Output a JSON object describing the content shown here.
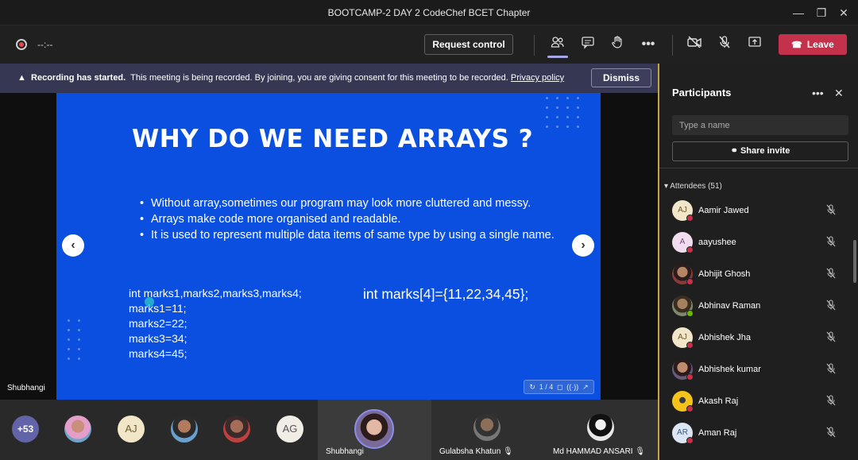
{
  "window": {
    "title": "BOOTCAMP-2 DAY 2 CodeChef BCET Chapter"
  },
  "toolbar": {
    "timer": "--:--",
    "request_control_label": "Request control",
    "leave_label": "Leave"
  },
  "banner": {
    "bold_text": "Recording has started.",
    "message": "This meeting is being recorded. By joining, you are giving consent for this meeting to be recorded.",
    "link_text": "Privacy policy",
    "dismiss_label": "Dismiss"
  },
  "slide": {
    "title": "WHY DO WE NEED ARRAYS ?",
    "bullets": [
      "Without array,sometimes our program may look more cluttered and messy.",
      "Arrays make code more organised and readable.",
      "It is used to represent multiple data items of same type by using a single name."
    ],
    "code_left": [
      "int marks1,marks2,marks3,marks4;",
      "marks1=11;",
      "marks2=22;",
      "marks3=34;",
      "marks4=45;"
    ],
    "code_right": "int marks[4]={11,22,34,45};",
    "page_indicator": "1 / 4",
    "presenter": "Shubhangi"
  },
  "gallery": {
    "overflow_count": "+53",
    "initials_1": "AJ",
    "initials_2": "AG",
    "tiles": [
      {
        "name": "Shubhangi"
      },
      {
        "name": "Gulabsha Khatun"
      },
      {
        "name": "Md HAMMAD ANSARI"
      }
    ]
  },
  "participants": {
    "title": "Participants",
    "search_placeholder": "Type a name",
    "share_label": "Share invite",
    "attendees_header": "Attendees (51)",
    "list": [
      {
        "name": "Aamir Jawed",
        "initials": "AJ",
        "status": "red"
      },
      {
        "name": "aayushee",
        "initials": "A",
        "status": "red"
      },
      {
        "name": "Abhijit Ghosh",
        "initials": "",
        "status": "red"
      },
      {
        "name": "Abhinav Raman",
        "initials": "",
        "status": "green"
      },
      {
        "name": "Abhishek Jha",
        "initials": "AJ",
        "status": "red"
      },
      {
        "name": "Abhishek kumar",
        "initials": "",
        "status": "red"
      },
      {
        "name": "Akash Raj",
        "initials": "",
        "status": "red"
      },
      {
        "name": "Aman Raj",
        "initials": "AR",
        "status": "red"
      }
    ]
  },
  "colors": {
    "slide_bg": "#0a4fe0",
    "leave": "#c4314b",
    "banner": "#353753",
    "accent": "#6264a7"
  }
}
